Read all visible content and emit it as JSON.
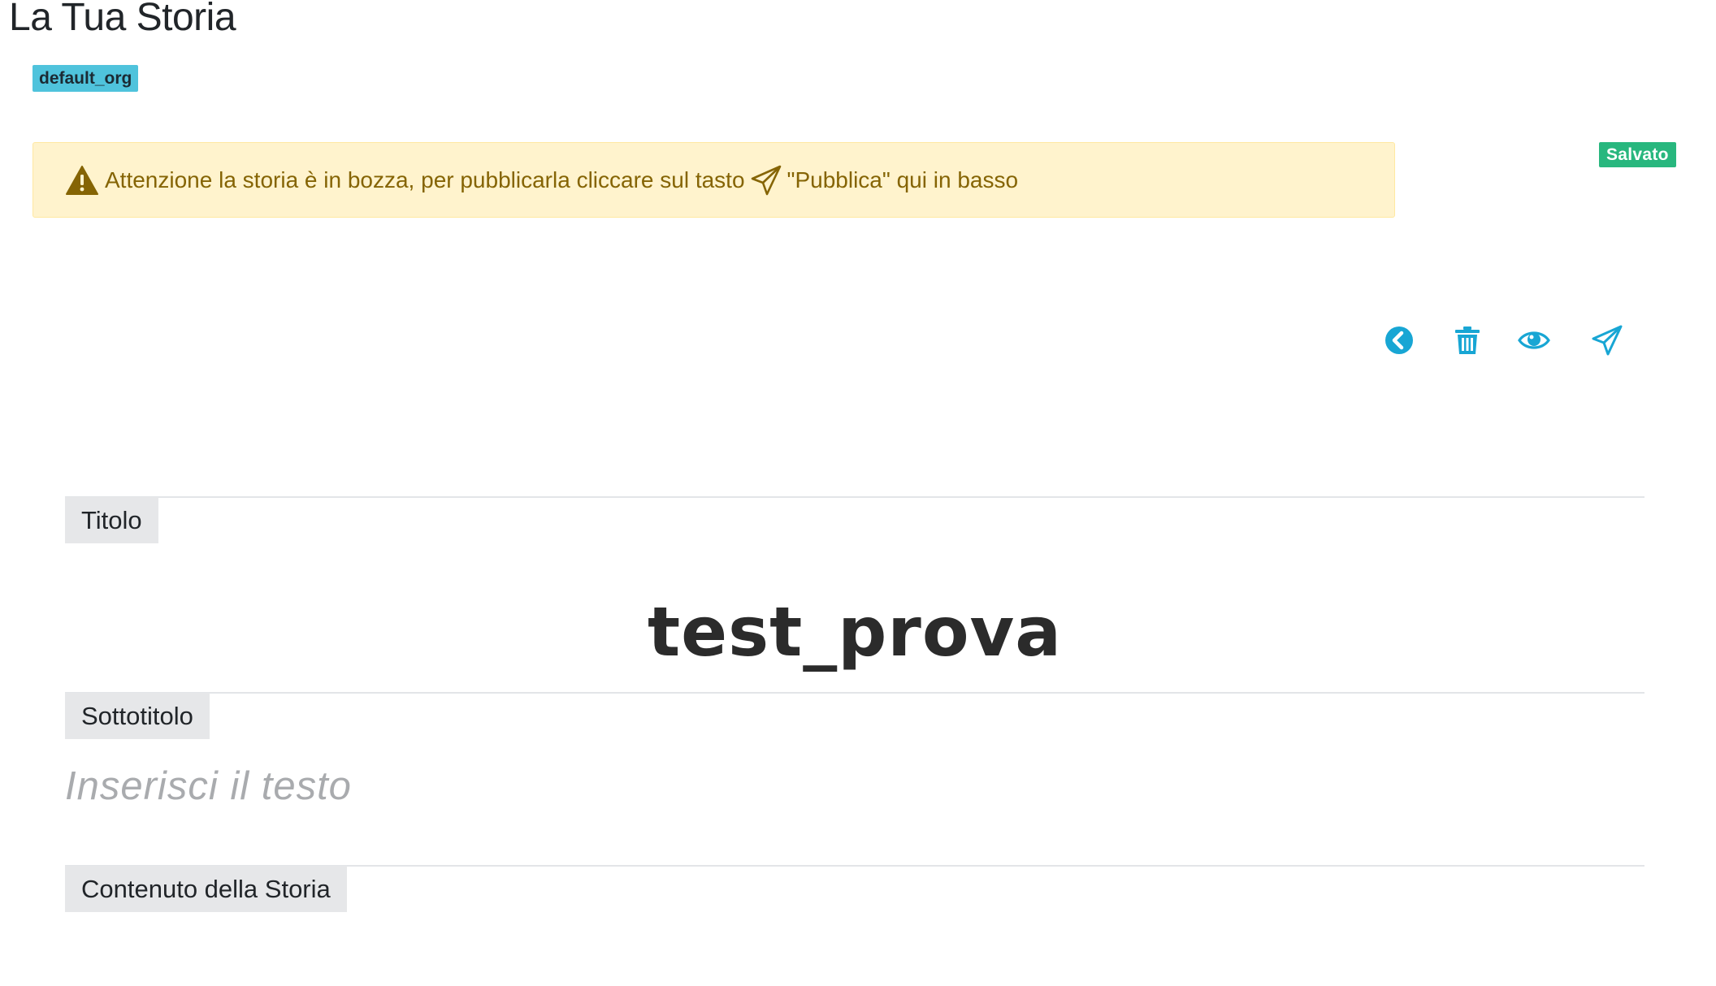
{
  "header": {
    "title": "La Tua Storia",
    "org_badge": "default_org"
  },
  "alert": {
    "text_before": "Attenzione la storia è in bozza, per pubblicarla cliccare sul tasto",
    "text_after": "\"Pubblica\" qui in basso",
    "warning_icon": "warning-triangle-icon",
    "send_icon": "paper-plane-icon",
    "color": "#856404",
    "background": "#fff3cd"
  },
  "status": {
    "saved_label": "Salvato",
    "color": "#28b77e"
  },
  "toolbar": {
    "icons": [
      "chevron-left-circle-icon",
      "trash-icon",
      "eye-icon",
      "paper-plane-icon"
    ],
    "color": "#18a6d4"
  },
  "editor": {
    "title_label": "Titolo",
    "title_value": "test_prova",
    "subtitle_label": "Sottotitolo",
    "subtitle_placeholder": "Inserisci il testo",
    "content_label": "Contenuto della Storia"
  }
}
